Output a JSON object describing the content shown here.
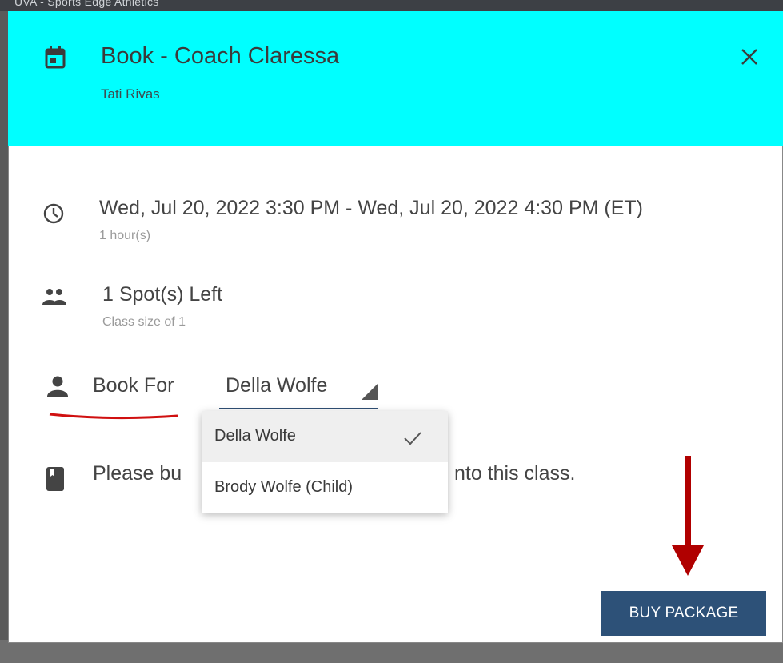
{
  "background": {
    "topbar_text": "UVA - Sports Edge Athletics"
  },
  "dialog": {
    "title": "Book - Coach Claressa",
    "subtitle": "Tati Rivas",
    "datetime": "Wed, Jul 20, 2022 3:30 PM - Wed, Jul 20, 2022 4:30 PM (ET)",
    "duration": "1 hour(s)",
    "spots": "1 Spot(s) Left",
    "class_size": "Class size of 1",
    "book_for_label": "Book For",
    "book_for_value": "Della Wolfe",
    "message_left": "Please bu",
    "message_right": "nto this class.",
    "buy_button": "BUY PACKAGE"
  },
  "dropdown": {
    "options": [
      {
        "label": "Della Wolfe",
        "selected": true
      },
      {
        "label": "Brody Wolfe (Child)",
        "selected": false
      }
    ]
  },
  "icons": {
    "header": "calendar-icon",
    "close": "close-icon",
    "time": "clock-icon",
    "spots": "people-icon",
    "book_for": "person-icon",
    "message": "book-icon",
    "check": "check-icon",
    "caret": "caret-down-icon"
  },
  "colors": {
    "header_bg": "#00ffff",
    "button_bg": "#2d5178",
    "annotation_red": "#cc0000"
  }
}
